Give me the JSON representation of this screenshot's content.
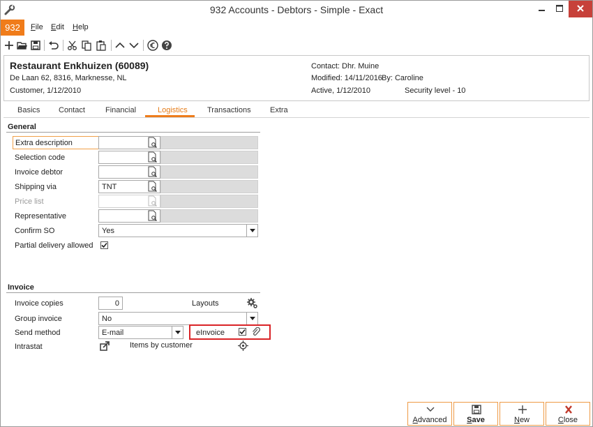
{
  "window": {
    "title": "932 Accounts - Debtors - Simple - Exact"
  },
  "menu": {
    "company": "932",
    "items": [
      {
        "key": "F",
        "rest": "ile"
      },
      {
        "key": "E",
        "rest": "dit"
      },
      {
        "key": "H",
        "rest": "elp"
      }
    ]
  },
  "colors": {
    "accent": "#f07c1a",
    "close": "#c7413a",
    "highlight": "#d92326"
  },
  "toolbar": {
    "icons": [
      "new-icon",
      "open-icon",
      "save-icon",
      "undo-icon",
      "cut-icon",
      "copy-icon",
      "paste-icon",
      "previous-icon",
      "next-icon",
      "euro-icon",
      "help-icon"
    ]
  },
  "header": {
    "name": "Restaurant Enkhuizen (60089)",
    "address": "De Laan 62, 8316, Marknesse, NL",
    "type": "Customer, 1/12/2010",
    "contact": "Contact: Dhr. Muine",
    "modified": "Modified: 14/11/2016",
    "by": "By: Caroline",
    "active": "Active, 1/12/2010",
    "security": "Security level - 10"
  },
  "tabs": [
    "Basics",
    "Contact",
    "Financial",
    "Logistics",
    "Transactions",
    "Extra"
  ],
  "active_tab": "Logistics",
  "general": {
    "title": "General",
    "extra_description": {
      "label": "Extra description",
      "value": ""
    },
    "selection_code": {
      "label": "Selection code",
      "value": ""
    },
    "invoice_debtor": {
      "label": "Invoice debtor",
      "value": ""
    },
    "shipping_via": {
      "label": "Shipping via",
      "value": "TNT"
    },
    "price_list": {
      "label": "Price list",
      "value": ""
    },
    "representative": {
      "label": "Representative",
      "value": ""
    },
    "confirm_so": {
      "label": "Confirm SO",
      "value": "Yes"
    },
    "partial_delivery": {
      "label": "Partial delivery allowed",
      "checked": true
    }
  },
  "invoice": {
    "title": "Invoice",
    "invoice_copies": {
      "label": "Invoice copies",
      "value": "0"
    },
    "layouts": {
      "label": "Layouts"
    },
    "group_invoice": {
      "label": "Group invoice",
      "value": "No"
    },
    "send_method": {
      "label": "Send method",
      "value": "E-mail"
    },
    "einvoice": {
      "label": "eInvoice",
      "checked": true
    },
    "intrastat": {
      "label": "Intrastat"
    },
    "items_by_customer": {
      "label": "Items by customer"
    }
  },
  "buttons": {
    "advanced": {
      "key": "A",
      "rest": "dvanced"
    },
    "save": {
      "key": "S",
      "rest": "ave"
    },
    "new": {
      "key": "N",
      "rest": "ew"
    },
    "close": {
      "key": "C",
      "rest": "lose"
    }
  }
}
